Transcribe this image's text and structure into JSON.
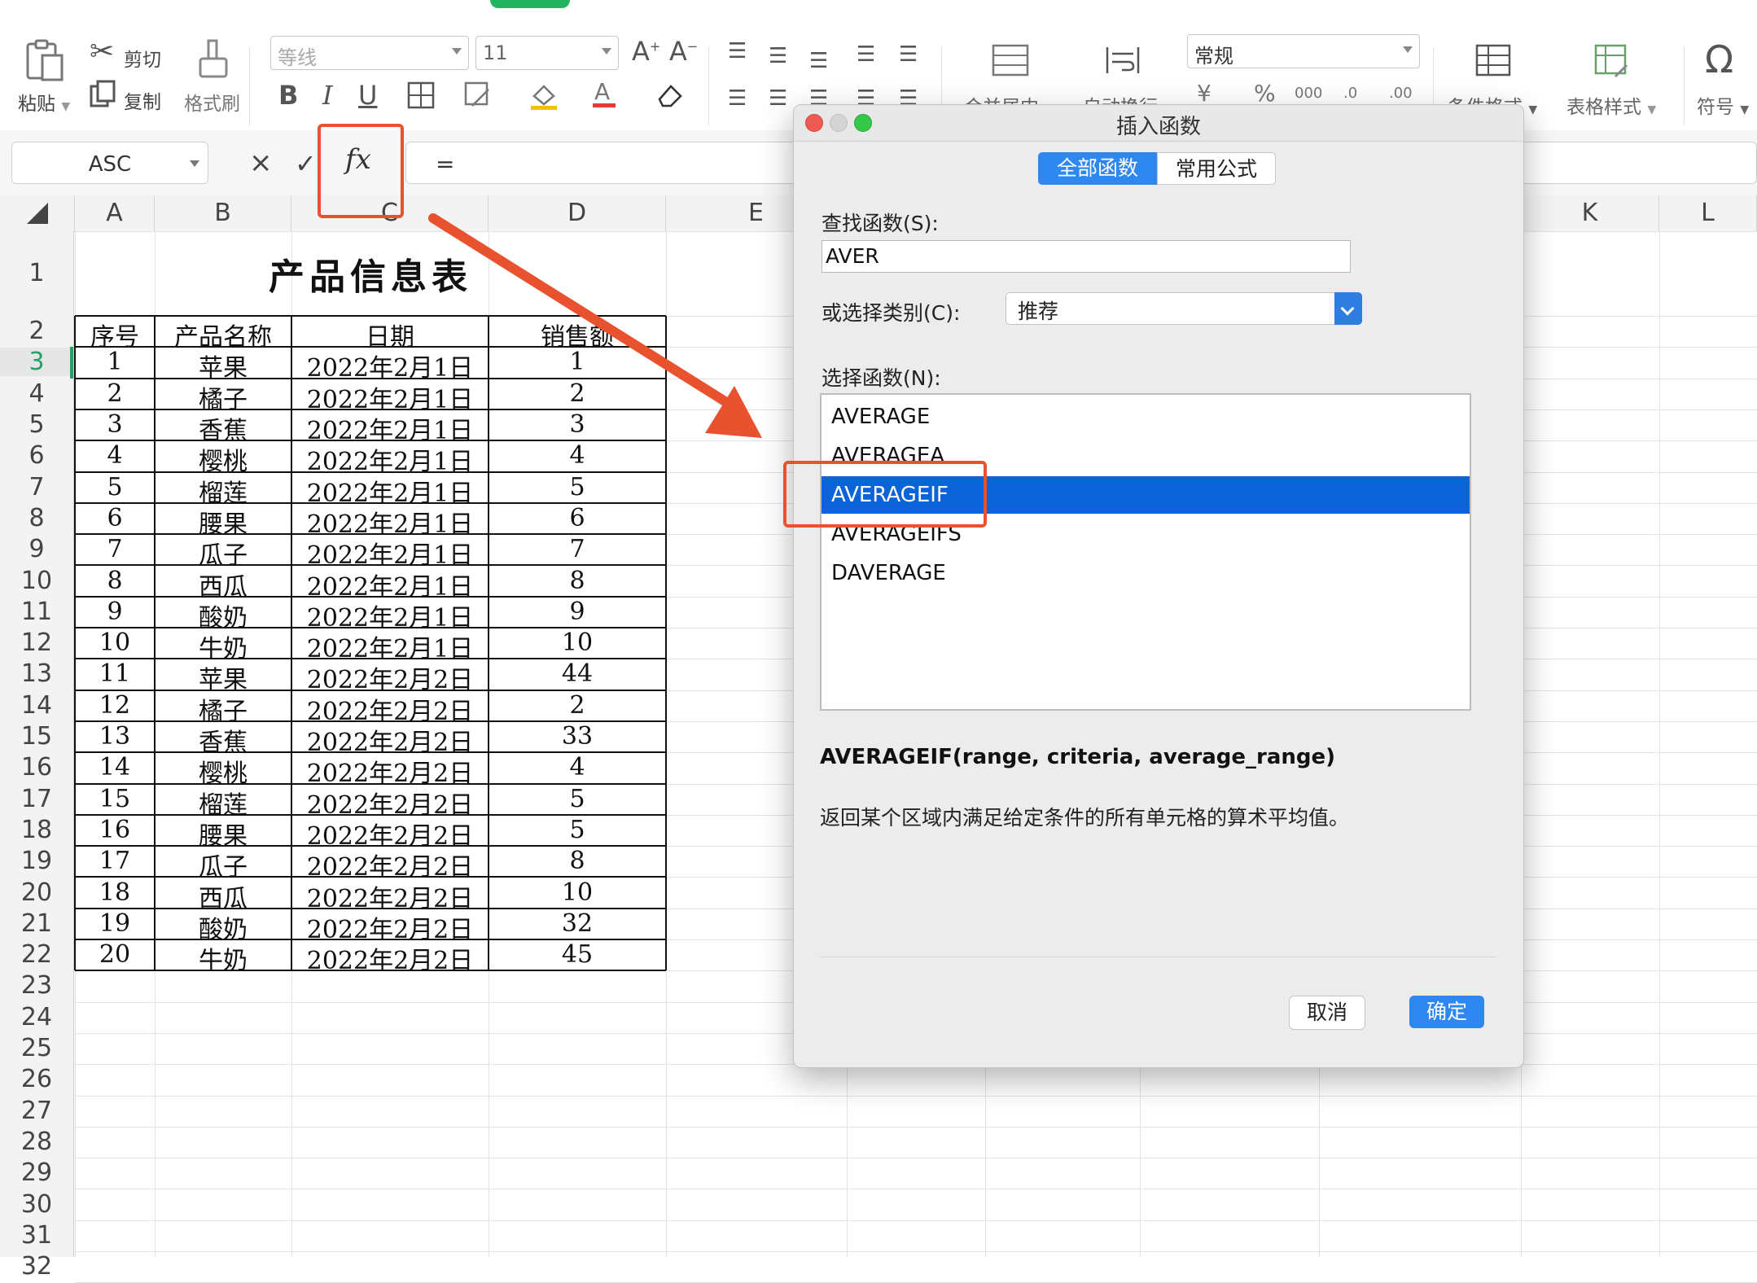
{
  "ribbon": {
    "paste_label": "粘贴",
    "cut_label": "剪切",
    "copy_label": "复制",
    "format_painter_label": "格式刷",
    "font_name": "等线",
    "font_size": "11",
    "number_format": "常规",
    "merge_label": "合并居中",
    "wrap_label": "自动换行",
    "cond_format_label": "条件格式",
    "table_style_label": "表格样式",
    "symbol_label": "符号"
  },
  "formula_bar": {
    "name_box": "ASC",
    "fx_label": "fx",
    "cancel_glyph": "×",
    "confirm_glyph": "✓",
    "formula": "="
  },
  "grid": {
    "columns": [
      "A",
      "B",
      "C",
      "D",
      "E",
      "K",
      "L"
    ],
    "rows": [
      "1",
      "2",
      "3",
      "4",
      "5",
      "6",
      "7",
      "8",
      "9",
      "10",
      "11",
      "12",
      "13",
      "14",
      "15",
      "16",
      "17",
      "18",
      "19",
      "20",
      "21",
      "22",
      "23",
      "24",
      "25",
      "26",
      "27",
      "28",
      "29",
      "30",
      "31",
      "32"
    ],
    "sheet_title": "产品信息表",
    "headers": [
      "序号",
      "产品名称",
      "日期",
      "销售额"
    ],
    "data": [
      [
        "1",
        "苹果",
        "2022年2月1日",
        "1"
      ],
      [
        "2",
        "橘子",
        "2022年2月1日",
        "2"
      ],
      [
        "3",
        "香蕉",
        "2022年2月1日",
        "3"
      ],
      [
        "4",
        "樱桃",
        "2022年2月1日",
        "4"
      ],
      [
        "5",
        "榴莲",
        "2022年2月1日",
        "5"
      ],
      [
        "6",
        "腰果",
        "2022年2月1日",
        "6"
      ],
      [
        "7",
        "瓜子",
        "2022年2月1日",
        "7"
      ],
      [
        "8",
        "西瓜",
        "2022年2月1日",
        "8"
      ],
      [
        "9",
        "酸奶",
        "2022年2月1日",
        "9"
      ],
      [
        "10",
        "牛奶",
        "2022年2月1日",
        "10"
      ],
      [
        "11",
        "苹果",
        "2022年2月2日",
        "44"
      ],
      [
        "12",
        "橘子",
        "2022年2月2日",
        "2"
      ],
      [
        "13",
        "香蕉",
        "2022年2月2日",
        "33"
      ],
      [
        "14",
        "樱桃",
        "2022年2月2日",
        "4"
      ],
      [
        "15",
        "榴莲",
        "2022年2月2日",
        "5"
      ],
      [
        "16",
        "腰果",
        "2022年2月2日",
        "5"
      ],
      [
        "17",
        "瓜子",
        "2022年2月2日",
        "8"
      ],
      [
        "18",
        "西瓜",
        "2022年2月2日",
        "10"
      ],
      [
        "19",
        "酸奶",
        "2022年2月2日",
        "32"
      ],
      [
        "20",
        "牛奶",
        "2022年2月2日",
        "45"
      ]
    ]
  },
  "dialog": {
    "title": "插入函数",
    "tabs": [
      "全部函数",
      "常用公式"
    ],
    "active_tab": 0,
    "search_label": "查找函数(S):",
    "search_value": "AVER",
    "category_label": "或选择类别(C):",
    "category_value": "推荐",
    "list_label": "选择函数(N):",
    "functions": [
      "AVERAGE",
      "AVERAGEA",
      "AVERAGEIF",
      "AVERAGEIFS",
      "DAVERAGE"
    ],
    "selected_index": 2,
    "signature": "AVERAGEIF(range, criteria, average_range)",
    "description": "返回某个区域内满足给定条件的所有单元格的算术平均值。",
    "cancel_label": "取消",
    "ok_label": "确定"
  },
  "colors": {
    "annotation": "#e8522f",
    "selection": "#0b63d8",
    "primary_button": "#2f88ef",
    "active_row_header": "#21a366"
  }
}
